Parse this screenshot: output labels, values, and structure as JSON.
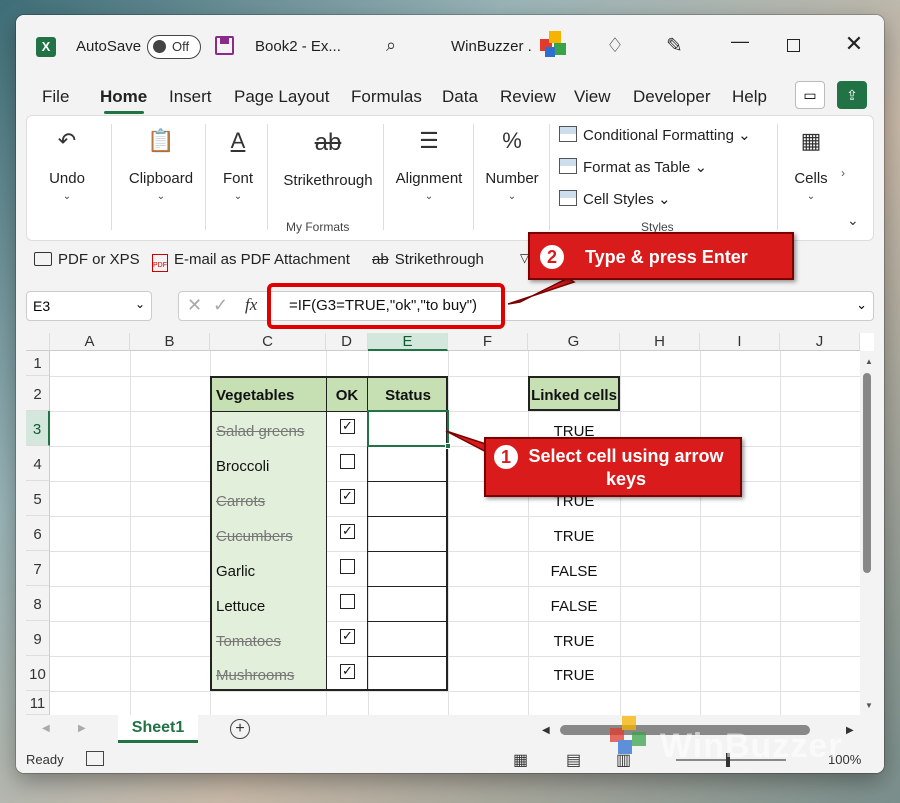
{
  "titlebar": {
    "autosave_label": "AutoSave",
    "autosave_state": "Off",
    "doc_title": "Book2  -  Ex...",
    "user_name": "WinBuzzer ."
  },
  "tabs": [
    "File",
    "Home",
    "Insert",
    "Page Layout",
    "Formulas",
    "Data",
    "Review",
    "View",
    "Developer",
    "Help"
  ],
  "ribbon": {
    "undo": "Undo",
    "clipboard": "Clipboard",
    "font": "Font",
    "strikethrough": "Strikethrough",
    "my_formats": "My Formats",
    "alignment": "Alignment",
    "number": "Number",
    "conditional_formatting": "Conditional Formatting",
    "format_as_table": "Format as Table",
    "cell_styles": "Cell Styles",
    "styles_group": "Styles",
    "cells": "Cells"
  },
  "qat": {
    "pdf_xps": "PDF or XPS",
    "email_pdf": "E-mail as PDF Attachment",
    "strikethrough": "Strikethrough"
  },
  "formula_bar": {
    "name_box": "E3",
    "fx": "fx",
    "formula": "=IF(G3=TRUE,\"ok\",\"to buy\")"
  },
  "columns": [
    "A",
    "B",
    "C",
    "D",
    "E",
    "F",
    "G",
    "H",
    "I",
    "J"
  ],
  "rows": [
    "1",
    "2",
    "3",
    "4",
    "5",
    "6",
    "7",
    "8",
    "9",
    "10",
    "11"
  ],
  "table": {
    "headers": [
      "Vegetables",
      "OK",
      "Status"
    ],
    "linked_header": "Linked cells",
    "items": [
      {
        "name": "Salad greens",
        "checked": true,
        "linked": "TRUE"
      },
      {
        "name": "Broccoli",
        "checked": false,
        "linked": ""
      },
      {
        "name": "Carrots",
        "checked": true,
        "linked": "TRUE"
      },
      {
        "name": "Cucumbers",
        "checked": true,
        "linked": "TRUE"
      },
      {
        "name": "Garlic",
        "checked": false,
        "linked": "FALSE"
      },
      {
        "name": "Lettuce",
        "checked": false,
        "linked": "FALSE"
      },
      {
        "name": "Tomatoes",
        "checked": true,
        "linked": "TRUE"
      },
      {
        "name": "Mushrooms",
        "checked": true,
        "linked": "TRUE"
      }
    ]
  },
  "sheet_tab": "Sheet1",
  "status": {
    "ready": "Ready",
    "zoom": "100%"
  },
  "callouts": {
    "one_num": "1",
    "one_text": "Select cell using arrow keys",
    "two_num": "2",
    "two_text": "Type & press Enter"
  },
  "watermark": "WinBuzzer",
  "colors": {
    "accent": "#217346",
    "table_fill": "#e2efda",
    "header_fill": "#c6e0b4",
    "callout": "#d91b1b"
  }
}
